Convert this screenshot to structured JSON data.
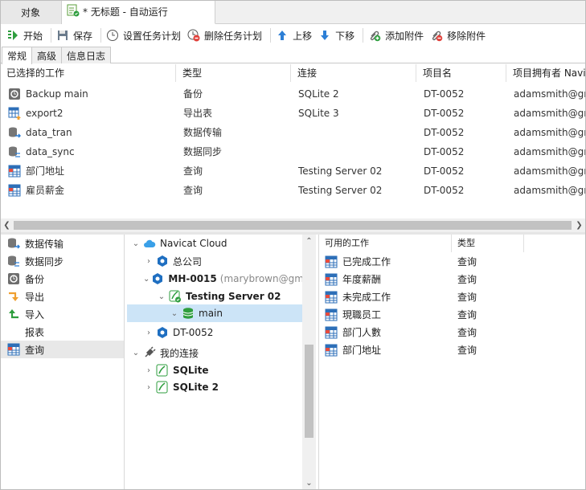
{
  "doc_tabs": {
    "objects": "对象",
    "current": "* 无标题 - 自动运行"
  },
  "toolbar": {
    "start": "开始",
    "save": "保存",
    "set_schedule": "设置任务计划",
    "delete_schedule": "删除任务计划",
    "move_up": "上移",
    "move_down": "下移",
    "add_attachment": "添加附件",
    "remove_attachment": "移除附件"
  },
  "sub_tabs": [
    "常规",
    "高级",
    "信息日志"
  ],
  "jobs": {
    "headers": [
      "已选择的工作",
      "类型",
      "连接",
      "项目名",
      "项目拥有者 Navi"
    ],
    "rows": [
      {
        "name": "Backup main",
        "type": "备份",
        "conn": "SQLite 2",
        "project": "DT-0052",
        "owner": "adamsmith@gmail",
        "icon": "backup-icon"
      },
      {
        "name": "export2",
        "type": "导出表",
        "conn": "SQLite 3",
        "project": "DT-0052",
        "owner": "adamsmith@gmail",
        "icon": "export-icon"
      },
      {
        "name": "data_tran",
        "type": "数据传输",
        "conn": "",
        "project": "DT-0052",
        "owner": "adamsmith@gmail",
        "icon": "data-transfer-icon"
      },
      {
        "name": "data_sync",
        "type": "数据同步",
        "conn": "",
        "project": "DT-0052",
        "owner": "adamsmith@gmail",
        "icon": "data-sync-icon"
      },
      {
        "name": "部门地址",
        "type": "查询",
        "conn": "Testing Server 02",
        "project": "DT-0052",
        "owner": "adamsmith@gmail",
        "icon": "query-icon"
      },
      {
        "name": "雇员薪金",
        "type": "查询",
        "conn": "Testing Server 02",
        "project": "DT-0052",
        "owner": "adamsmith@gmail",
        "icon": "query-icon"
      }
    ]
  },
  "categories": [
    "数据传输",
    "数据同步",
    "备份",
    "导出",
    "导入",
    "报表",
    "查询"
  ],
  "tree": {
    "cloud": "Navicat Cloud",
    "hq": "总公司",
    "project": "MH-0015",
    "project_owner": "(marybrown@gmail",
    "server": "Testing Server 02",
    "db": "main",
    "project2": "DT-0052",
    "my_conn": "我的连接",
    "sqlite": "SQLite",
    "sqlite2": "SQLite 2"
  },
  "available": {
    "headers": [
      "可用的工作",
      "类型"
    ],
    "rows": [
      {
        "name": "已完成工作",
        "type": "查询"
      },
      {
        "name": "年度薪酬",
        "type": "查询"
      },
      {
        "name": "未完成工作",
        "type": "查询"
      },
      {
        "name": "現職员工",
        "type": "查询"
      },
      {
        "name": "部门人數",
        "type": "查询"
      },
      {
        "name": "部门地址",
        "type": "查询"
      }
    ]
  },
  "colors": {
    "accent": "#1e88e5",
    "selection": "#cce4f7",
    "green": "#2e9e3e",
    "orange": "#f0a030"
  }
}
